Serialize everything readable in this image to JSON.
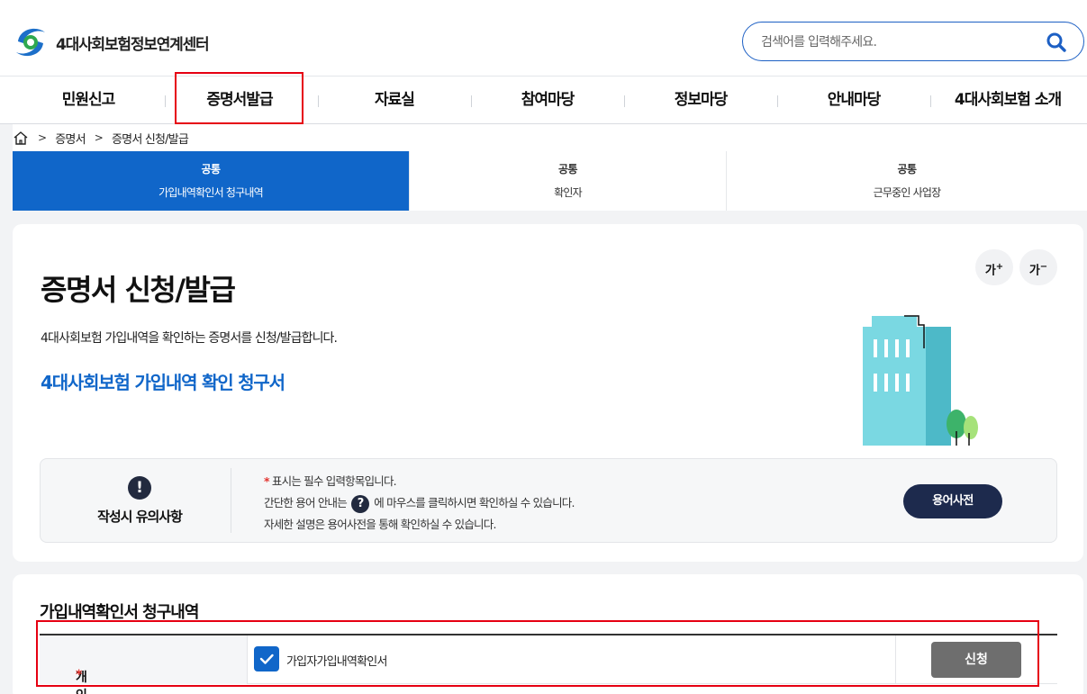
{
  "header": {
    "logo_text": "4대사회보험정보연계센터",
    "search_placeholder": "검색어를 입력해주세요."
  },
  "gnb": {
    "items": [
      "민원신고",
      "증명서발급",
      "자료실",
      "참여마당",
      "정보마당",
      "안내마당",
      "4대사회보험 소개"
    ]
  },
  "breadcrumb": {
    "items": [
      "증명서",
      "증명서 신청/발급"
    ]
  },
  "tabs": [
    {
      "category": "공통",
      "label": "가입내역확인서 청구내역",
      "active": true
    },
    {
      "category": "공통",
      "label": "확인자",
      "active": false
    },
    {
      "category": "공통",
      "label": "근무중인 사업장",
      "active": false
    }
  ],
  "main": {
    "font_up": "가",
    "font_down": "가",
    "title": "증명서 신청/발급",
    "description": "4대사회보험 가입내역을 확인하는 증명서를 신청/발급합니다.",
    "subtitle": "4대사회보험 가입내역 확인 청구서"
  },
  "notice": {
    "title": "작성시 유의사항",
    "line1_star": "*",
    "line1": " 표시는 필수 입력항목입니다.",
    "line2_a": "간단한 용어 안내는 ",
    "line2_b": " 에 마우스를 클릭하시면 확인하실 수 있습니다.",
    "line3": "자세한 설명은 용어사전을 통해 확인하실 수 있습니다.",
    "dict_button": "용어사전"
  },
  "request_section": {
    "title": "가입내역확인서 청구내역",
    "row_label": "개인용",
    "required_mark": "*",
    "checkbox_label": "가입자가입내역확인서",
    "checked": true,
    "apply_button": "신청"
  },
  "colors": {
    "accent": "#1066c9",
    "highlight": "#e60012",
    "dark_button": "#1d2a4d"
  }
}
